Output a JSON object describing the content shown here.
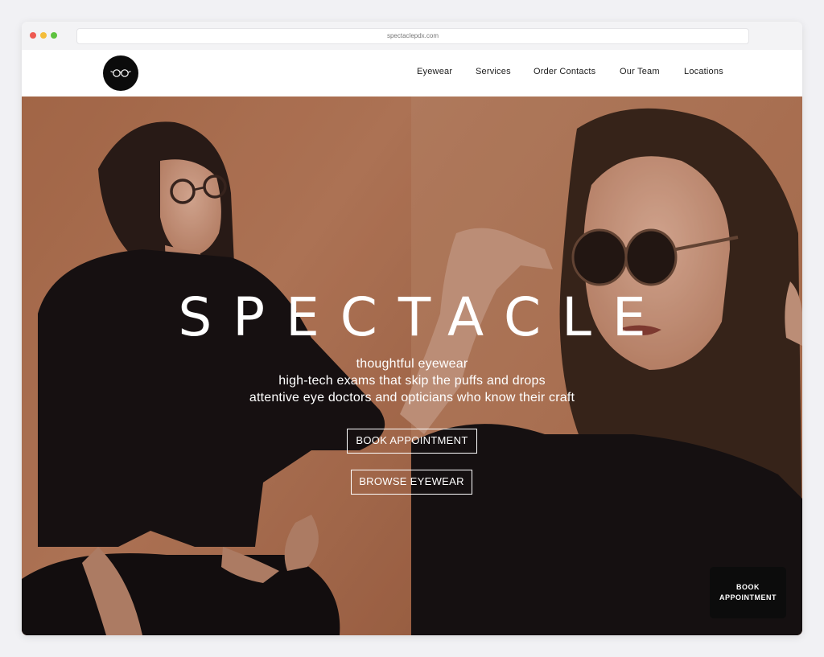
{
  "browser": {
    "url": "spectaclepdx.com"
  },
  "nav": {
    "logo_icon": "spectacles-logo-icon",
    "items": [
      {
        "label": "Eyewear"
      },
      {
        "label": "Services"
      },
      {
        "label": "Order Contacts"
      },
      {
        "label": "Our Team"
      },
      {
        "label": "Locations"
      }
    ]
  },
  "hero": {
    "brand": "SPECTACLE",
    "taglines": [
      "thoughtful eyewear",
      "high-tech exams that skip the puffs and drops",
      "attentive eye doctors and opticians who know their craft"
    ],
    "book_label": "BOOK APPOINTMENT",
    "browse_label": "BROWSE EYEWEAR"
  },
  "floating_button": {
    "line1": "BOOK",
    "line2": "APPOINTMENT"
  },
  "colors": {
    "page_bg": "#f1f1f4",
    "hero_bg_left": "#b97a59",
    "hero_bg_right": "#c48566",
    "logo_bg": "#0b0b0b",
    "button_border": "#ffffff"
  }
}
